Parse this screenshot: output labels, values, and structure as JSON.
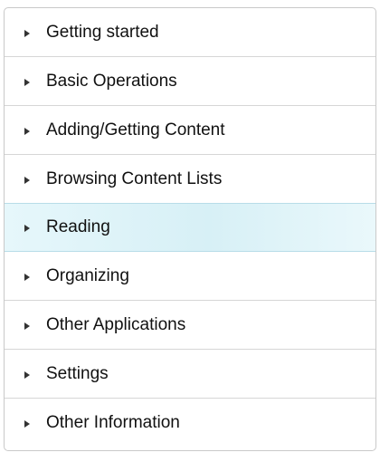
{
  "nav": {
    "items": [
      {
        "label": "Getting started",
        "icon": "triangle-right-icon"
      },
      {
        "label": "Basic Operations",
        "icon": "triangle-right-icon"
      },
      {
        "label": "Adding/Getting Content",
        "icon": "triangle-right-icon"
      },
      {
        "label": "Browsing Content Lists",
        "icon": "triangle-right-icon"
      },
      {
        "label": "Reading",
        "icon": "triangle-right-icon",
        "active": true
      },
      {
        "label": "Organizing",
        "icon": "triangle-right-icon"
      },
      {
        "label": "Other Applications",
        "icon": "triangle-right-icon"
      },
      {
        "label": "Settings",
        "icon": "triangle-right-icon"
      },
      {
        "label": "Other Information",
        "icon": "triangle-right-icon"
      }
    ],
    "active_color": "#d7f0f6",
    "arrow_color": "#333333"
  }
}
